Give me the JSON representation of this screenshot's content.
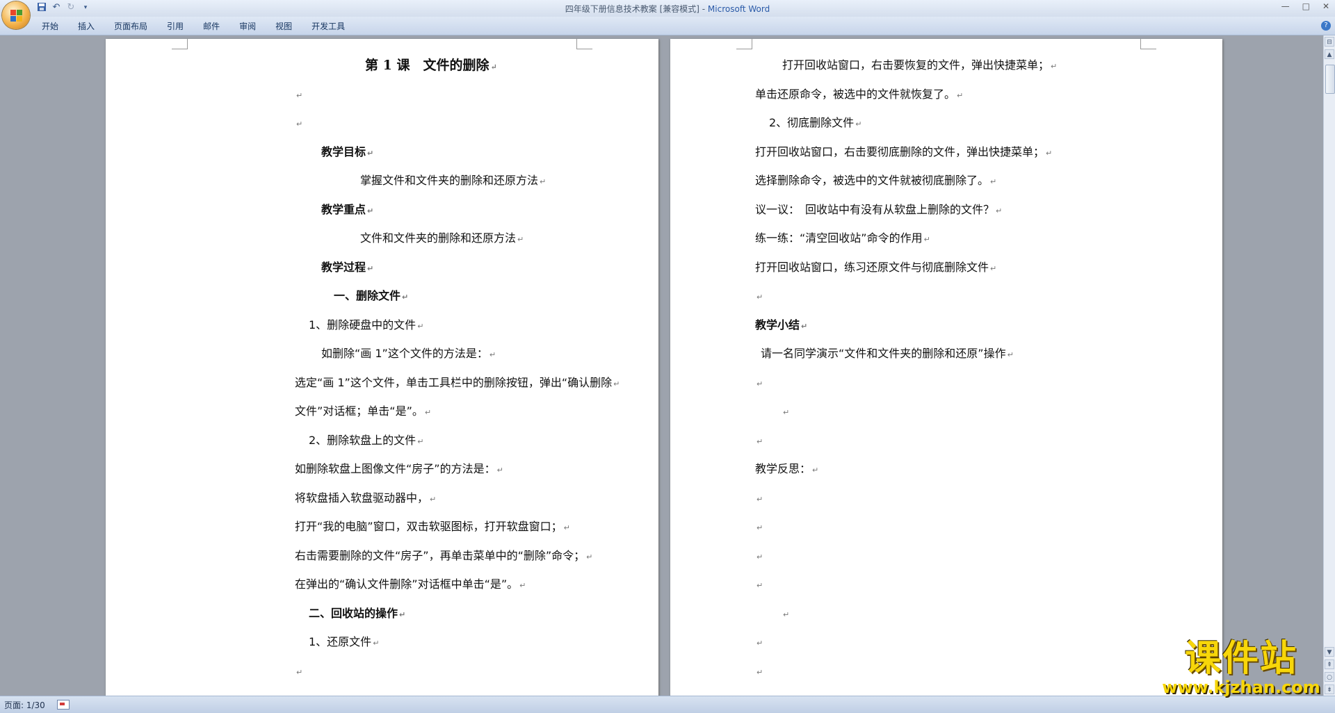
{
  "window": {
    "title_doc": "四年级下册信息技术教案 [兼容模式] - ",
    "title_app": "Microsoft Word",
    "controls": [
      "—",
      "□",
      "✕"
    ]
  },
  "qat": {
    "save_icon": "save-icon",
    "undo_icon": "undo-icon",
    "redo_icon": "redo-icon",
    "customize_icon": "customize-qat-icon"
  },
  "ribbon": {
    "tabs": [
      "开始",
      "插入",
      "页面布局",
      "引用",
      "邮件",
      "审阅",
      "视图",
      "开发工具"
    ],
    "help": "?"
  },
  "page1": {
    "lines": [
      {
        "text": "第 1 课　文件的删除",
        "style": "title"
      },
      {
        "text": "",
        "style": "normal"
      },
      {
        "text": "",
        "style": "normal"
      },
      {
        "text": "教学目标",
        "style": "bold"
      },
      {
        "text": "掌握文件和文件夹的删除和还原方法",
        "style": "normal"
      },
      {
        "text": "教学重点",
        "style": "bold"
      },
      {
        "text": "文件和文件夹的删除和还原方法",
        "style": "normal"
      },
      {
        "text": "教学过程",
        "style": "bold"
      },
      {
        "text": "一、删除文件",
        "style": "bold"
      },
      {
        "text": "1、删除硬盘中的文件",
        "style": "normal"
      },
      {
        "text": "如删除“画 1”这个文件的方法是：",
        "style": "normal"
      },
      {
        "text": "选定“画 1”这个文件，单击工具栏中的删除按钮，弹出“确认删除",
        "style": "normal"
      },
      {
        "text": "文件”对话框；单击“是”。",
        "style": "normal"
      },
      {
        "text": "2、删除软盘上的文件",
        "style": "normal"
      },
      {
        "text": "如删除软盘上图像文件“房子”的方法是：",
        "style": "normal"
      },
      {
        "text": "将软盘插入软盘驱动器中，",
        "style": "normal"
      },
      {
        "text": "打开“我的电脑”窗口，双击软驱图标，打开软盘窗口；",
        "style": "normal"
      },
      {
        "text": "右击需要删除的文件“房子”，再单击菜单中的“删除”命令；",
        "style": "normal"
      },
      {
        "text": "在弹出的“确认文件删除”对话框中单击“是”。",
        "style": "normal"
      },
      {
        "text": "二、回收站的操作",
        "style": "bold"
      },
      {
        "text": "1、还原文件",
        "style": "normal"
      },
      {
        "text": "",
        "style": "normal"
      }
    ]
  },
  "page2": {
    "lines": [
      {
        "text": "打开回收站窗口，右击要恢复的文件，弹出快捷菜单；",
        "style": "normal"
      },
      {
        "text": "单击还原命令，被选中的文件就恢复了。",
        "style": "normal"
      },
      {
        "text": "2、彻底删除文件",
        "style": "normal"
      },
      {
        "text": "打开回收站窗口，右击要彻底删除的文件，弹出快捷菜单；",
        "style": "normal"
      },
      {
        "text": "选择删除命令，被选中的文件就被彻底删除了。",
        "style": "normal"
      },
      {
        "text": "议一议：　回收站中有没有从软盘上删除的文件？",
        "style": "normal"
      },
      {
        "text": "练一练：“清空回收站”命令的作用",
        "style": "normal"
      },
      {
        "text": "打开回收站窗口，练习还原文件与彻底删除文件",
        "style": "normal"
      },
      {
        "text": "",
        "style": "normal"
      },
      {
        "text": "教学小结",
        "style": "bold"
      },
      {
        "text": "请一名同学演示“文件和文件夹的删除和还原”操作",
        "style": "normal"
      },
      {
        "text": "",
        "style": "normal"
      },
      {
        "text": "",
        "style": "normal"
      },
      {
        "text": "",
        "style": "normal"
      },
      {
        "text": "教学反思：",
        "style": "normal"
      },
      {
        "text": "",
        "style": "normal"
      },
      {
        "text": "",
        "style": "normal"
      },
      {
        "text": "",
        "style": "normal"
      },
      {
        "text": "",
        "style": "normal"
      },
      {
        "text": "",
        "style": "normal"
      },
      {
        "text": "",
        "style": "normal"
      },
      {
        "text": "",
        "style": "normal"
      }
    ]
  },
  "paragraph_mark": "↵",
  "statusbar": {
    "page_label": "页面: 1/30"
  },
  "watermark": {
    "text": "课件站",
    "url": "www.kjzhan.com"
  },
  "colors": {
    "app_title": "#2a5aa8",
    "watermark": "#f7d60a"
  }
}
